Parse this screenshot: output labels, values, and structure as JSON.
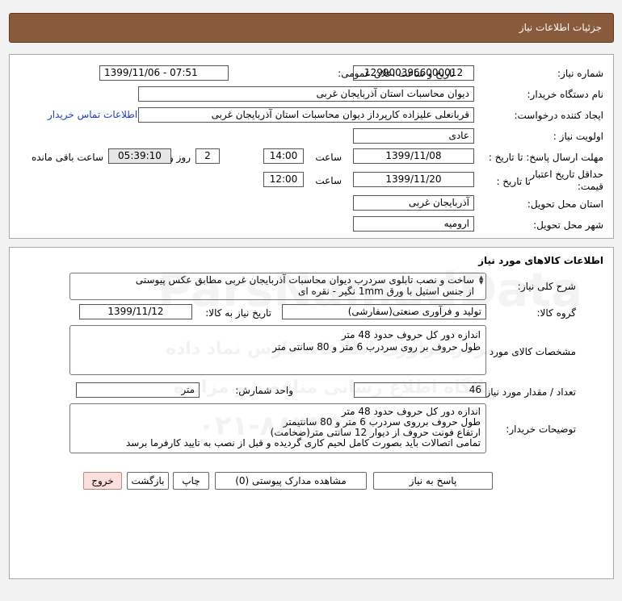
{
  "header": {
    "title": "جزئیات اطلاعات نیاز"
  },
  "details": {
    "need_number_label": "شماره نیاز:",
    "need_number": "1299003966000012",
    "announce_label": "تاریخ و ساعت اعلان عمومی:",
    "announce_value": "1399/11/06 - 07:51",
    "buyer_label": "نام دستگاه خریدار:",
    "buyer_value": "دیوان محاسبات استان آذربایجان غربی",
    "creator_label": "ایجاد کننده درخواست:",
    "creator_value": "قربانعلی علیزاده کارپرداز دیوان محاسبات استان آذربایجان غربی",
    "contact_link": "اطلاعات تماس خریدار",
    "priority_label": "اولویت نیاز :",
    "priority_value": "عادی",
    "deadline_label": "مهلت ارسال پاسخ: تا تاریخ :",
    "deadline_date": "1399/11/08",
    "time_label": "ساعت",
    "deadline_time": "14:00",
    "days_value": "2",
    "days_label": "روز و",
    "remaining_time": "05:39:10",
    "remaining_label": "ساعت باقی مانده",
    "validity_label_1": "حداقل تاریخ اعتبار",
    "validity_label_2": "قیمت:",
    "validity_to_label": "تا تاریخ :",
    "validity_date": "1399/11/20",
    "validity_time_label": "ساعت",
    "validity_time": "12:00",
    "province_label": "استان محل تحویل:",
    "province_value": "آذربایجان غربی",
    "city_label": "شهر محل تحویل:",
    "city_value": "ارومیه"
  },
  "goods": {
    "section_title": "اطلاعات کالاهای مورد نیاز",
    "desc_label": "شرح کلی نیاز:",
    "desc_line1": "ساخت و نصب تابلوی سردرب دیوان محاسبات آذربایجان غربی مطابق عکس پیوستی",
    "desc_line2": "از جنس استیل با ورق 1mm نگیر - نقره ای",
    "group_label": "گروه کالا:",
    "group_value": "تولید و فرآوری صنعتی(سفارشی)",
    "need_date_label": "تاریخ نیاز به کالا:",
    "need_date": "1399/11/12",
    "specs_label": "مشخصات کالای مورد نیاز:",
    "specs_line1": "اندازه دور کل حروف حدود 48 متر",
    "specs_line2": "طول حروف بر روی سردرب 6 متر و 80 سانتی متر",
    "qty_label": "تعداد / مقدار مورد نیاز:",
    "qty_value": "46",
    "unit_label": "واحد شمارش:",
    "unit_value": "متر",
    "buyer_notes_label": "توضیحات خریدار:",
    "notes_line1": "اندازه دور کل حروف حدود 48 متر",
    "notes_line2": "طول حروف برروی سردرب 6 متر و 80 سانتیمتر",
    "notes_line3": "ارتفاع فونت حروف از دیوار 12 سانتی متر(ضخامت)",
    "notes_line4": "تمامی اتصالات باید بصورت کامل لحیم کاری گردیده و قبل از نصب به تایید کارفرما برسد"
  },
  "buttons": {
    "reply": "پاسخ به نیاز",
    "attachments": "مشاهده مدارک پیوستی (0)",
    "print": "چاپ",
    "back": "بازگشت",
    "exit": "خروج"
  },
  "watermark": {
    "brand": "ParsNamadData",
    "line_a": "مرکز فراوری اطلاعات پارس نماد داده",
    "line_b": "پایگاه اطلاع رسانی مناقصه و مزایده",
    "phone": "۰۲۱-۸۸۳۴۹۶۷۰"
  },
  "colors": {
    "header_bg": "#8a5a3c",
    "link": "#1d3fbf",
    "exit_bg": "#fcdede"
  }
}
